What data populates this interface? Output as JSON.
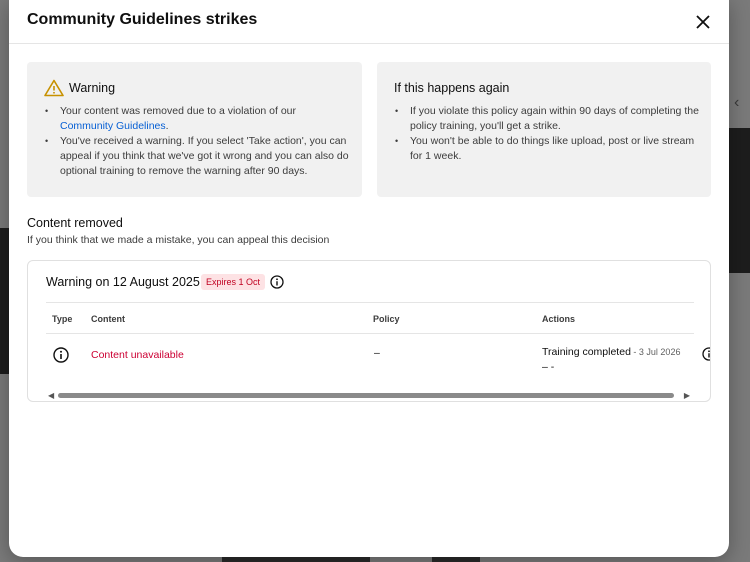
{
  "dialog": {
    "title": "Community Guidelines strikes",
    "close_icon": "close-icon"
  },
  "warning_card": {
    "icon": "warning-triangle-icon",
    "title": "Warning",
    "bullet1_text": "Your content was removed due to a violation of our ",
    "bullet1_link": "Community Guidelines",
    "bullet1_end": ".",
    "bullet2": "You've received a warning. If you select 'Take action', you can appeal if you think that we've got it wrong and you can also do optional training to remove the warning after 90 days."
  },
  "again_card": {
    "title": "If this happens again",
    "bullet1": "If you violate this policy again within 90 days of completing the policy training, you'll get a strike.",
    "bullet2": "You won't be able to do things like upload, post or live stream for 1 week."
  },
  "content_removed": {
    "title": "Content removed",
    "subtitle": "If you think that we made a mistake, you can appeal this decision"
  },
  "strike": {
    "title": "Warning on 12 August 2025",
    "badge": "Expires 1 Oct",
    "badge_color": "#c00020",
    "info_icon": "info-icon"
  },
  "table": {
    "headers": [
      "Type",
      "Content",
      "Policy",
      "Actions"
    ],
    "rows": [
      {
        "type_icon": "info-icon",
        "content": "Content unavailable",
        "policy": "–",
        "action": "Training completed",
        "action_date": " - 3 Jul 2026",
        "action_line2": "– -"
      }
    ]
  },
  "scrollbar": {
    "left_arrow": "◀",
    "right_arrow": "▶"
  }
}
